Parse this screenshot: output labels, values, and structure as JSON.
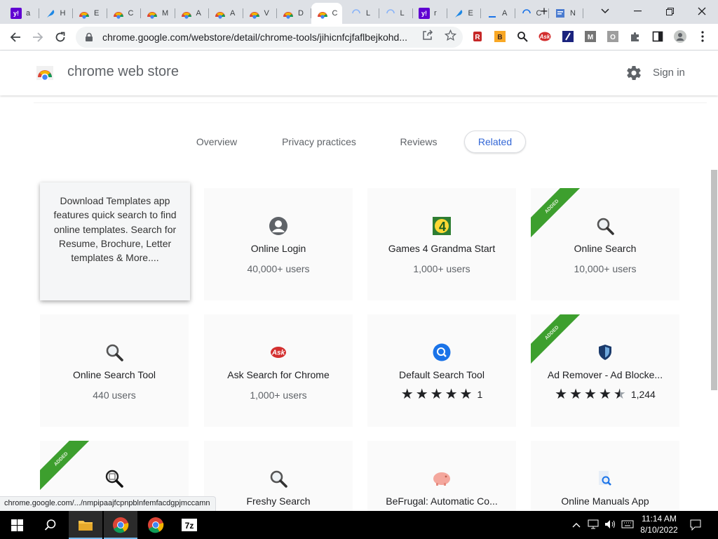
{
  "browser": {
    "tabs": [
      {
        "letter": "a",
        "favicon": "yahoo-icon",
        "color": "#6001d2",
        "active": false
      },
      {
        "letter": "H",
        "favicon": "feather-icon",
        "color": "#1e88e5",
        "active": false
      },
      {
        "letter": "E",
        "favicon": "webstore-icon",
        "color": "#e94235",
        "active": false
      },
      {
        "letter": "C",
        "favicon": "webstore-icon",
        "color": "#e94235",
        "active": false
      },
      {
        "letter": "M",
        "favicon": "webstore-icon",
        "color": "#e94235",
        "active": false
      },
      {
        "letter": "A",
        "favicon": "webstore-icon",
        "color": "#e94235",
        "active": false
      },
      {
        "letter": "A",
        "favicon": "webstore-icon",
        "color": "#e94235",
        "active": false
      },
      {
        "letter": "V",
        "favicon": "webstore-icon",
        "color": "#e94235",
        "active": false
      },
      {
        "letter": "D",
        "favicon": "webstore-icon",
        "color": "#e94235",
        "active": false
      },
      {
        "letter": "C",
        "favicon": "webstore-icon",
        "color": "#e94235",
        "active": true
      },
      {
        "letter": "L",
        "favicon": "loading-icon",
        "color": "#8ab4f8",
        "active": false
      },
      {
        "letter": "L",
        "favicon": "loading-icon",
        "color": "#8ab4f8",
        "active": false
      },
      {
        "letter": "r",
        "favicon": "yahoo-icon",
        "color": "#6001d2",
        "active": false
      },
      {
        "letter": "E",
        "favicon": "feather-icon",
        "color": "#1e88e5",
        "active": false
      },
      {
        "letter": "A",
        "favicon": "underline-icon",
        "color": "#1a73e8",
        "active": false
      },
      {
        "letter": "C",
        "favicon": "loading-icon",
        "color": "#1a73e8",
        "active": false
      },
      {
        "letter": "N",
        "favicon": "document-icon",
        "color": "#4a7bd0",
        "active": false
      }
    ],
    "new_tab_label": "+",
    "url": "chrome.google.com/webstore/detail/chrome-tools/jihicnfcjfaflbejkohd...",
    "extensions": [
      "red-extension-icon",
      "yellow-extension-icon",
      "magnifier-extension-icon",
      "ask-extension-icon",
      "blue-extension-icon",
      "m-extension-icon",
      "o-extension-icon",
      "puzzle-icon",
      "side-panel-icon",
      "profile-icon"
    ]
  },
  "store": {
    "title": "chrome web store",
    "signin": "Sign in"
  },
  "detail_tabs": [
    {
      "label": "Overview",
      "active": false
    },
    {
      "label": "Privacy practices",
      "active": false
    },
    {
      "label": "Reviews",
      "active": false
    },
    {
      "label": "Related",
      "active": true
    }
  ],
  "popup": {
    "text": "Download Templates app features quick search to find online templates. Search for Resume, Brochure, Letter templates & More...."
  },
  "cards": [
    {
      "name": "Online Login",
      "users": "40,000+ users",
      "icon": "user-icon",
      "added": false
    },
    {
      "name": "Games 4 Grandma Start",
      "users": "1,000+ users",
      "icon": "games4grandma-icon",
      "added": false
    },
    {
      "name": "Online Search",
      "users": "10,000+ users",
      "icon": "search-icon",
      "added": true,
      "added_label": "ADDED"
    },
    {
      "name": "Online Search Tool",
      "users": "440 users",
      "icon": "search-icon",
      "added": false
    },
    {
      "name": "Ask Search for Chrome",
      "users": "1,000+ users",
      "icon": "ask-icon",
      "added": false
    },
    {
      "name": "Default Search Tool",
      "stars": 5,
      "rating_count": "1",
      "icon": "blue-search-icon",
      "added": false
    },
    {
      "name": "Ad Remover - Ad Blocke...",
      "stars": 4.5,
      "rating_count": "1,244",
      "icon": "shield-icon",
      "added": true,
      "added_label": "ADDED"
    },
    {
      "name": "",
      "users": "",
      "icon": "search-doc-icon",
      "added": true,
      "added_label": "ADDED"
    },
    {
      "name": "Freshy Search",
      "users": "",
      "icon": "search-icon",
      "added": false
    },
    {
      "name": "BeFrugal: Automatic Co...",
      "users": "",
      "icon": "piggy-bank-icon",
      "added": false
    },
    {
      "name": "Online Manuals App",
      "users": "",
      "icon": "manual-search-icon",
      "added": false
    }
  ],
  "status_url": "chrome.google.com/.../nmpipaajfcpnpblnfemfacdgpjmccamn",
  "taskbar": {
    "apps": [
      "file-explorer-icon",
      "chrome-icon",
      "chrome-alt-icon",
      "7zip-icon"
    ],
    "time": "11:14 AM",
    "date": "8/10/2022"
  }
}
